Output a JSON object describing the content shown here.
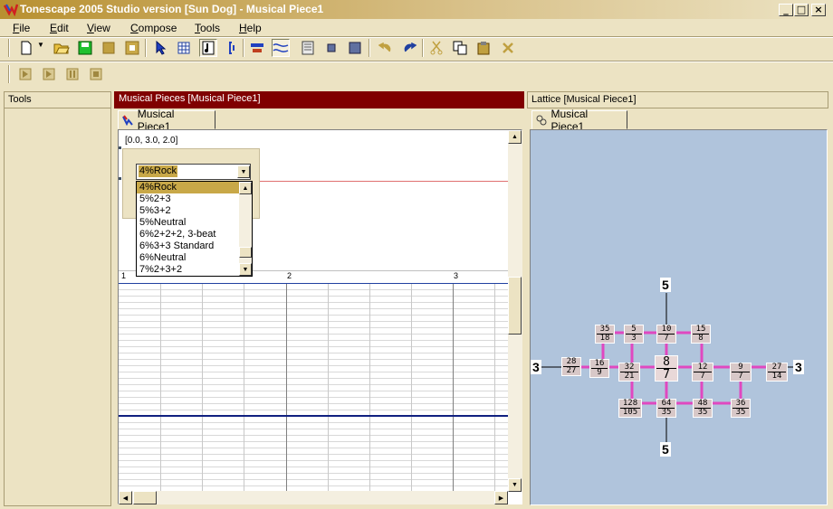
{
  "window": {
    "title": "Tonescape 2005 Studio  version [Sun Dog]  -  Musical Piece1",
    "minimize": "_",
    "maximize": "□",
    "close": "×"
  },
  "menu": [
    "File",
    "Edit",
    "View",
    "Compose",
    "Tools",
    "Help"
  ],
  "toolbar_icons": [
    "new-file-icon",
    "open-folder-icon",
    "save-icon",
    "stop-icon",
    "grid-icon",
    "pointer-icon",
    "lattice-icon",
    "note-icon",
    "bracket-icon",
    "align-icon",
    "wave-icon",
    "document-icon",
    "small-square-icon",
    "square-icon",
    "undo-icon",
    "redo-icon",
    "cut-icon",
    "copy-icon",
    "paste-icon",
    "delete-icon"
  ],
  "transport_icons": [
    "play-icon",
    "step-icon",
    "pause-icon",
    "stop-icon"
  ],
  "tools_panel": {
    "title": "Tools"
  },
  "musical_panel": {
    "title": "Musical Pieces  [Musical Piece1]",
    "tab_label": "Musical Piece1",
    "coord": "[0.0, 3.0, 2.0]",
    "selected_value": "4%Rock",
    "options": [
      "4%Rock",
      "5%2+3",
      "5%3+2",
      "5%Neutral",
      "6%2+2+2, 3-beat",
      "6%3+3 Standard",
      "6%Neutral",
      "7%2+3+2"
    ],
    "ruler": [
      "1",
      "2",
      "3"
    ]
  },
  "lattice_panel": {
    "title": "Lattice  [Musical Piece1]",
    "tab_label": "Musical Piece1",
    "axis_labels": {
      "top": "5",
      "bottom": "5",
      "left": "3",
      "right": "3"
    },
    "nodes": [
      {
        "n": "35",
        "d": "18"
      },
      {
        "n": "5",
        "d": "3"
      },
      {
        "n": "10",
        "d": "7"
      },
      {
        "n": "15",
        "d": "8"
      },
      {
        "n": "28",
        "d": "27"
      },
      {
        "n": "16",
        "d": "9"
      },
      {
        "n": "32",
        "d": "21"
      },
      {
        "n": "8",
        "d": "7"
      },
      {
        "n": "12",
        "d": "7"
      },
      {
        "n": "9",
        "d": "7"
      },
      {
        "n": "27",
        "d": "14"
      },
      {
        "n": "128",
        "d": "105"
      },
      {
        "n": "64",
        "d": "35"
      },
      {
        "n": "48",
        "d": "35"
      },
      {
        "n": "36",
        "d": "35"
      }
    ]
  }
}
